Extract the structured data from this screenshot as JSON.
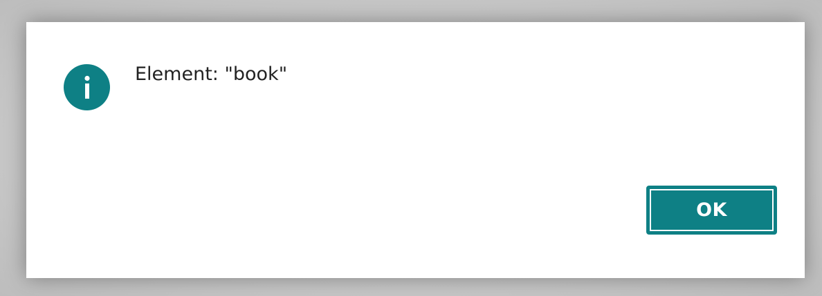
{
  "dialog": {
    "message": "Element: \"book\"",
    "icon": "info-icon",
    "accent_color": "#0e8085",
    "ok_label": "OK"
  }
}
